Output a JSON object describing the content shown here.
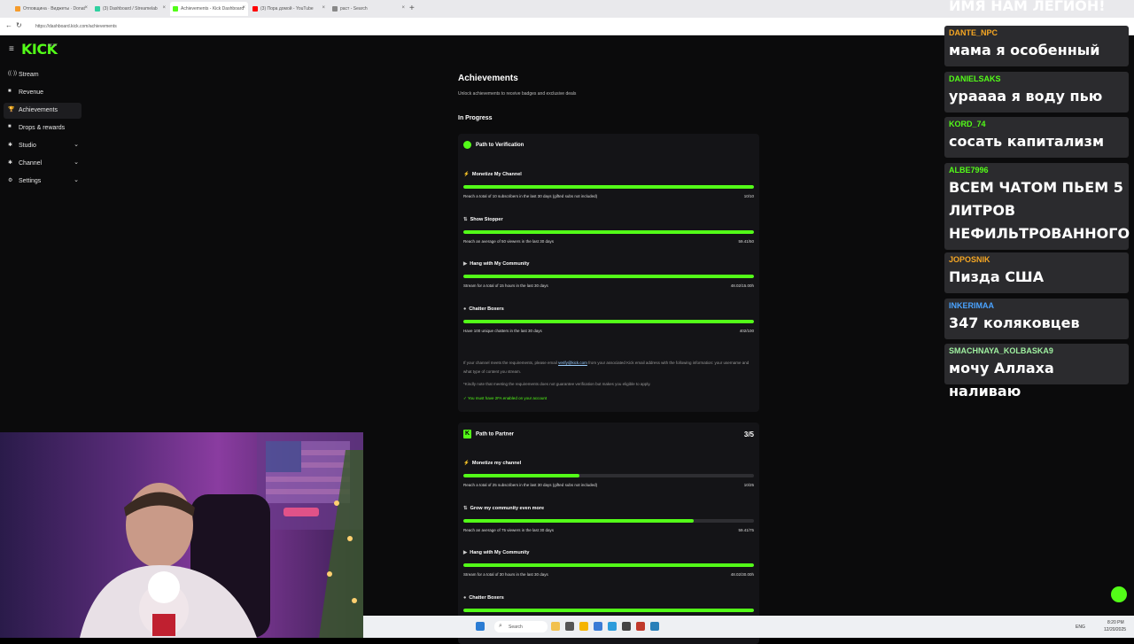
{
  "browser": {
    "tabs": [
      {
        "label": "Отповщина · Виджеты · Donat",
        "active": false,
        "color": "#f59b2b"
      },
      {
        "label": "(3) Dashboard / Streamelab",
        "active": false,
        "color": "#2fd0a0"
      },
      {
        "label": "Achievements - Kick Dashboard",
        "active": true,
        "color": "#53fc18"
      },
      {
        "label": "(3) Пора домой - YouTube",
        "active": false,
        "color": "#ff0000"
      },
      {
        "label": "раст - Search",
        "active": false,
        "color": "#888888"
      }
    ],
    "new_tab": "+",
    "url": "https://dashboard.kick.com/achievements"
  },
  "sidebar": {
    "logo": "KICK",
    "items": [
      {
        "label": "Stream",
        "icon": "broadcast-icon",
        "glyph": "((·))",
        "expand": false,
        "active": false
      },
      {
        "label": "Revenue",
        "icon": "revenue-icon",
        "glyph": "■",
        "expand": false,
        "active": false
      },
      {
        "label": "Achievements",
        "icon": "trophy-icon",
        "glyph": "🏆",
        "expand": false,
        "active": true
      },
      {
        "label": "Drops & rewards",
        "icon": "gift-icon",
        "glyph": "■",
        "expand": false,
        "active": false
      },
      {
        "label": "Studio",
        "icon": "studio-icon",
        "glyph": "✱",
        "expand": true,
        "active": false
      },
      {
        "label": "Channel",
        "icon": "channel-icon",
        "glyph": "✱",
        "expand": true,
        "active": false
      },
      {
        "label": "Settings",
        "icon": "gear-icon",
        "glyph": "⚙",
        "expand": true,
        "active": false
      }
    ]
  },
  "main": {
    "title": "Achievements",
    "subtitle": "Unlock achievements to receive badges and exclusive deals",
    "section": "In Progress",
    "verification": {
      "title": "Path to Verification",
      "items": [
        {
          "name": "Monetize My Channel",
          "icon": "⚡",
          "desc": "Reach a total of 10 subscribers in the last 30 days (gifted subs not included)",
          "value": "10/10",
          "progress": 1.0
        },
        {
          "name": "Show Stopper",
          "icon": "⇅",
          "desc": "Reach an average of 50 viewers in the last 30 days",
          "value": "59.41/50",
          "progress": 1.0
        },
        {
          "name": "Hang with My Community",
          "icon": "▶",
          "desc": "Stream for a total of 15 hours in the last 30 days",
          "value": "48.02/15.00h",
          "progress": 1.0
        },
        {
          "name": "Chatter Boxers",
          "icon": "●",
          "desc": "Have 100 unique chatters in the last 30 days",
          "value": "402/100",
          "progress": 1.0
        }
      ],
      "info_pre": "If your channel meets the requirements, please email ",
      "info_link": "verify@kick.com",
      "info_post": " from your associated Kick email address with the following information: your username and what type of content you stream.",
      "note": "*Kindly note that meeting the requirements does not guarantee verification but makes you eligible to apply.",
      "twofa": "✓  You must have 2FA enabled on your account"
    },
    "partner": {
      "title": "Path to Partner",
      "count": "3/5",
      "items": [
        {
          "name": "Monetize my channel",
          "icon": "⚡",
          "desc": "Reach a total of 25 subscribers in the last 30 days (gifted subs not included)",
          "value": "10/25",
          "progress": 0.4
        },
        {
          "name": "Grow my community even more",
          "icon": "⇅",
          "desc": "Reach an average of 75 viewers in the last 30 days",
          "value": "59.41/75",
          "progress": 0.792
        },
        {
          "name": "Hang with My Community",
          "icon": "▶",
          "desc": "Stream for a total of 30 hours in the last 30 days",
          "value": "48.02/30.00h",
          "progress": 1.0
        },
        {
          "name": "Chatter Boxers",
          "icon": "●",
          "desc": "",
          "value": "",
          "progress": 1.0
        }
      ]
    }
  },
  "chat": {
    "header_text": "ИМЯ НАМ ЛЕГИОН!",
    "messages": [
      {
        "user": "DANTE_NPC",
        "text": "мама я особенный",
        "color": "#f5a623"
      },
      {
        "user": "DANIELSAKS",
        "text": "урааaa я воду пью",
        "color": "#53fc18"
      },
      {
        "user": "KORD_74",
        "text": "сосать капитализм",
        "color": "#53fc18"
      },
      {
        "user": "ALBE7996",
        "text": "ВСЕМ ЧАТОМ ПЬЕМ 5 ЛИТРОВ НЕФИЛЬТРОВАННОГО",
        "color": "#53fc18"
      },
      {
        "user": "JOPOSNIK",
        "text": "Пизда США",
        "color": "#f5a623"
      },
      {
        "user": "INKERIMAA",
        "text": "347 коляковцев",
        "color": "#4aa3ff"
      },
      {
        "user": "SMACHNAYA_KOLBASKA9",
        "text": "мочу Аллаха наливаю",
        "color": "#9ff0a0"
      }
    ]
  },
  "taskbar": {
    "search": "Search",
    "tray_lang": "ENG",
    "time": "8:20 PM",
    "date": "12/20/2025"
  }
}
